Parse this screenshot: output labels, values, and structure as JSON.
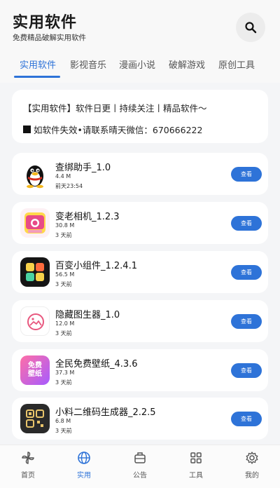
{
  "header": {
    "title": "实用软件",
    "subtitle": "免费精品破解实用软件"
  },
  "tabs": [
    {
      "label": "实用软件",
      "active": true
    },
    {
      "label": "影视音乐",
      "active": false
    },
    {
      "label": "漫画小说",
      "active": false
    },
    {
      "label": "破解游戏",
      "active": false
    },
    {
      "label": "原创工具",
      "active": false
    }
  ],
  "notice": {
    "line1": "【实用软件】软件日更丨持续关注丨精品软件～",
    "line2": "如软件失效•请联系晴天微信：670666222"
  },
  "apps": [
    {
      "name": "查绑助手_1.0",
      "size": "4.4 M",
      "time": "前天23:54",
      "button": "查看",
      "icon": "penguin-icon"
    },
    {
      "name": "变老相机_1.2.3",
      "size": "30.8 M",
      "time": "3 天前",
      "button": "查看",
      "icon": "camera-icon"
    },
    {
      "name": "百变小组件_1.2.4.1",
      "size": "56.5 M",
      "time": "3 天前",
      "button": "查看",
      "icon": "widget-icon"
    },
    {
      "name": "隐藏图生器_1.0",
      "size": "12.0 M",
      "time": "3 天前",
      "button": "查看",
      "icon": "image-icon"
    },
    {
      "name": "全民免费壁纸_4.3.6",
      "size": "37.3 M",
      "time": "3 天前",
      "button": "查看",
      "icon": "wallpaper-icon",
      "icon_text_1": "免费",
      "icon_text_2": "壁纸"
    },
    {
      "name": "小料二维码生成器_2.2.5",
      "size": "6.8 M",
      "time": "3 天前",
      "button": "查看",
      "icon": "qrcode-icon"
    }
  ],
  "bottom_nav": [
    {
      "label": "首页",
      "icon": "pinwheel-icon",
      "active": false
    },
    {
      "label": "实用",
      "icon": "globe-icon",
      "active": true
    },
    {
      "label": "公告",
      "icon": "briefcase-icon",
      "active": false
    },
    {
      "label": "工具",
      "icon": "grid-icon",
      "active": false
    },
    {
      "label": "我的",
      "icon": "gear-icon",
      "active": false
    }
  ],
  "colors": {
    "accent": "#2e73d8",
    "background": "#f4f5f7",
    "card": "#ffffff"
  }
}
